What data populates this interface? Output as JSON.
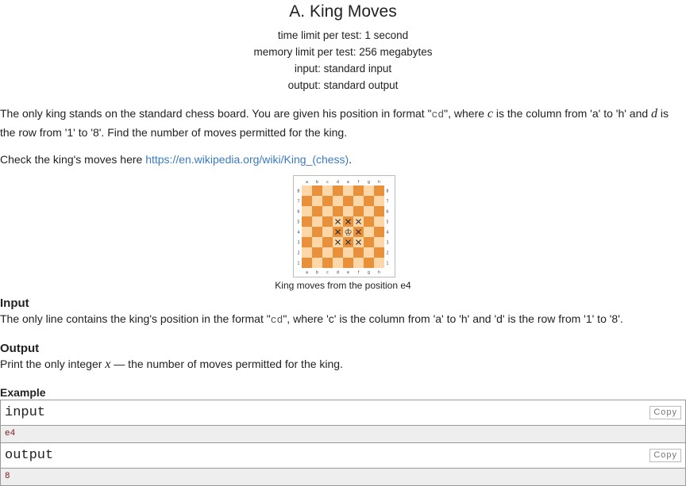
{
  "title": "A. King Moves",
  "limits": {
    "time": "time limit per test: 1 second",
    "memory": "memory limit per test: 256 megabytes",
    "input": "input: standard input",
    "output": "output: standard output"
  },
  "statement": {
    "p1_a": "The only king stands on the standard chess board. You are given his position in format \"",
    "p1_code": "cd",
    "p1_b": "\", where ",
    "p1_var_c": "c",
    "p1_c": " is the column from 'a' to 'h' and ",
    "p1_var_d": "d",
    "p1_d": " is the row from '1' to '8'. Find the number of moves permitted for the king.",
    "p2_a": "Check the king's moves here ",
    "p2_link": "https://en.wikipedia.org/wiki/King_(chess)",
    "p2_b": "."
  },
  "figure": {
    "files": [
      "a",
      "b",
      "c",
      "d",
      "e",
      "f",
      "g",
      "h"
    ],
    "ranks": [
      "8",
      "7",
      "6",
      "5",
      "4",
      "3",
      "2",
      "1"
    ],
    "king_square": "e4",
    "move_squares": [
      "d5",
      "e5",
      "f5",
      "d4",
      "f4",
      "d3",
      "e3",
      "f3"
    ],
    "light_color": "#fdd7a8",
    "dark_color": "#e8913a",
    "caption": "King moves from the position e4"
  },
  "input_section": {
    "title": "Input",
    "text_a": "The only line contains the king's position in the format \"",
    "code": "cd",
    "text_b": "\", where 'c' is the column from 'a' to 'h' and 'd' is the row from '1' to '8'."
  },
  "output_section": {
    "title": "Output",
    "text_a": "Print the only integer ",
    "var": "x",
    "text_b": " — the number of moves permitted for the king."
  },
  "example": {
    "title": "Example",
    "input_label": "input",
    "input_value": "e4",
    "output_label": "output",
    "output_value": "8",
    "copy_label": "Copy"
  }
}
